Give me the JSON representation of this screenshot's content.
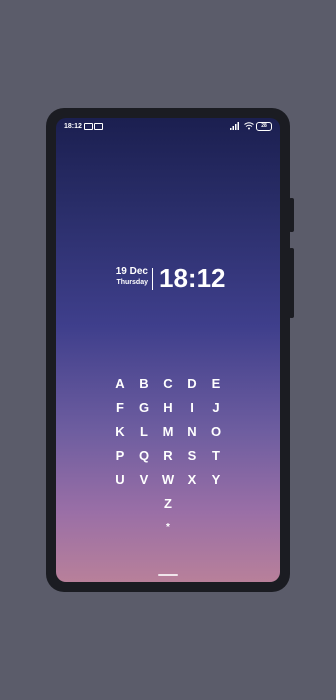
{
  "status_bar": {
    "time": "18:12",
    "battery": "28",
    "icons": [
      "message-icon",
      "message-icon",
      "signal-icon",
      "wifi-icon",
      "battery-icon"
    ]
  },
  "clock": {
    "date": "19  Dec",
    "weekday": "Thursday",
    "time": "18:12"
  },
  "keypad": {
    "rows": [
      [
        "A",
        "B",
        "C",
        "D",
        "E"
      ],
      [
        "F",
        "G",
        "H",
        "I",
        "J"
      ],
      [
        "K",
        "L",
        "M",
        "N",
        "O"
      ],
      [
        "P",
        "Q",
        "R",
        "S",
        "T"
      ],
      [
        "U",
        "V",
        "W",
        "X",
        "Y"
      ],
      [
        "Z"
      ],
      [
        "*"
      ]
    ]
  },
  "colors": {
    "gradient_top": "#1b1f50",
    "gradient_bottom": "#b8809a",
    "frame": "#1b1c22",
    "background": "#5b5c6a"
  }
}
